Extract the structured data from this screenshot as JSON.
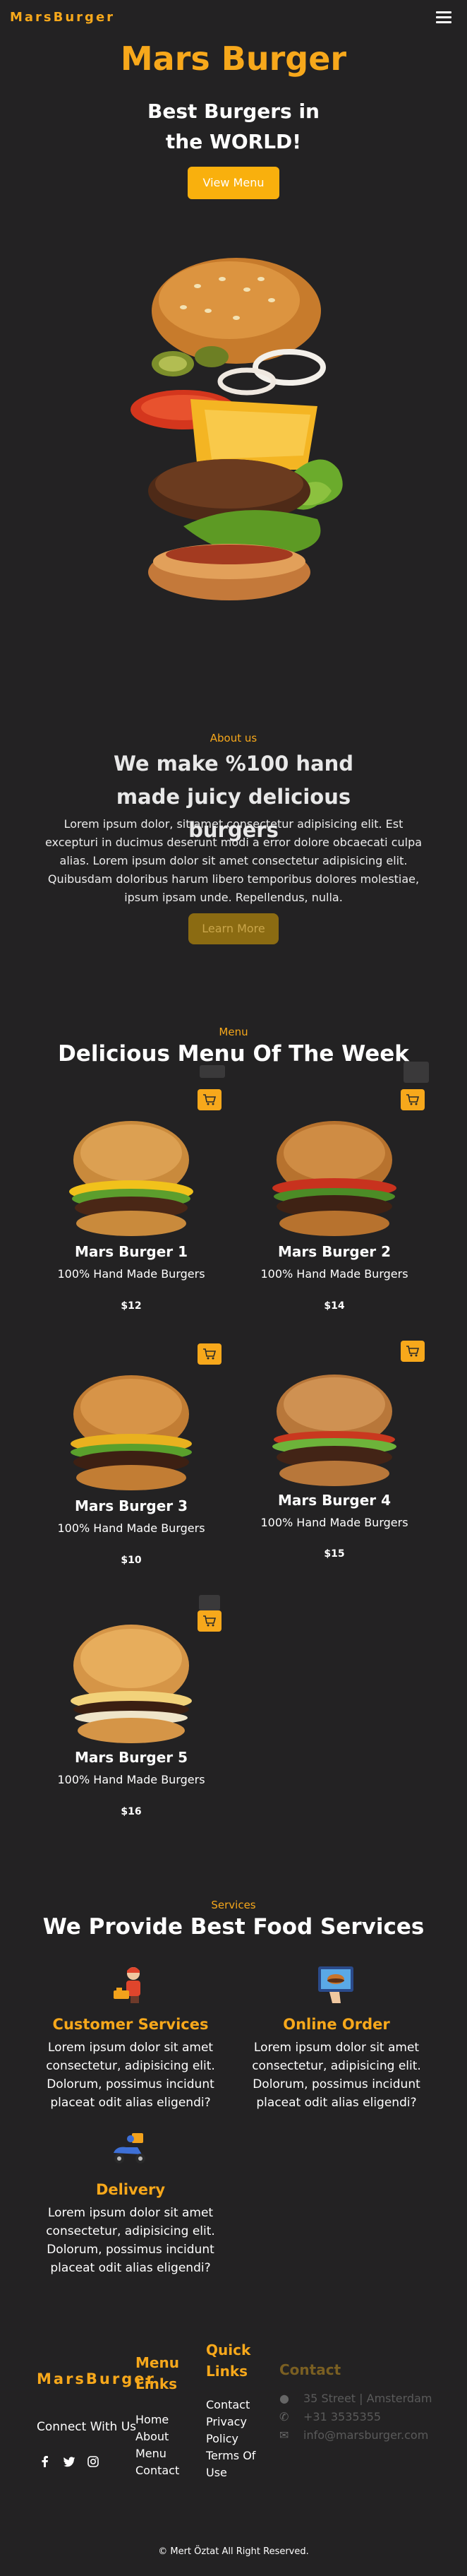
{
  "header": {
    "brand": "MarsBurger"
  },
  "hero": {
    "title": "Mars Burger",
    "subtitle": "Best Burgers in the WORLD!",
    "button": "View Menu"
  },
  "about": {
    "kicker": "About us",
    "title": "We make %100 hand made juicy delicious burgers",
    "text": "Lorem ipsum dolor, sit amet consectetur adipisicing elit. Est excepturi in ducimus deserunt modi a error dolore obcaecati culpa alias. Lorem ipsum dolor sit amet consectetur adipisicing elit. Quibusdam doloribus harum libero temporibus dolores molestiae, ipsum ipsam unde. Repellendus, nulla.",
    "button": "Learn More"
  },
  "menu": {
    "kicker": "Menu",
    "title": "Delicious Menu Of The Week",
    "items": [
      {
        "name": "Mars Burger 1",
        "desc": "100% Hand Made Burgers",
        "price": "$12"
      },
      {
        "name": "Mars Burger 2",
        "desc": "100% Hand Made Burgers",
        "price": "$14"
      },
      {
        "name": "Mars Burger 3",
        "desc": "100% Hand Made Burgers",
        "price": "$10"
      },
      {
        "name": "Mars Burger 4",
        "desc": "100% Hand Made Burgers",
        "price": "$15"
      },
      {
        "name": "Mars Burger 5",
        "desc": "100% Hand Made Burgers",
        "price": "$16"
      }
    ]
  },
  "services": {
    "kicker": "Services",
    "title": "We Provide Best Food Services",
    "items": [
      {
        "title": "Customer Services",
        "text": "Lorem ipsum dolor sit amet consectetur, adipisicing elit. Dolorum, possimus incidunt placeat odit alias eligendi?"
      },
      {
        "title": "Online Order",
        "text": "Lorem ipsum dolor sit amet consectetur, adipisicing elit. Dolorum, possimus incidunt placeat odit alias eligendi?"
      },
      {
        "title": "Delivery",
        "text": "Lorem ipsum dolor sit amet consectetur, adipisicing elit. Dolorum, possimus incidunt placeat odit alias eligendi?"
      }
    ]
  },
  "footer": {
    "brand": "MarsBurger",
    "connect": "Connect With Us",
    "menu_title": "Menu Links",
    "menu_links": [
      "Home",
      "About",
      "Menu",
      "Contact"
    ],
    "quick_title": "Quick Links",
    "quick_links": [
      "Contact",
      "Privacy Policy",
      "Terms Of Use"
    ],
    "contact_title": "Contact",
    "contact": [
      "35 Street | Amsterdam",
      "+31 3535355",
      "info@marsburger.com"
    ],
    "copyright": "© Mert Öztat All Right Reserved."
  },
  "colors": {
    "accent": "#f7a81b",
    "background": "#232223"
  }
}
